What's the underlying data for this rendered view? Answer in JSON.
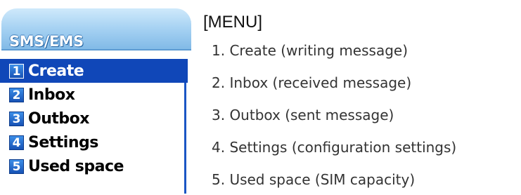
{
  "screen": {
    "title": "SMS/EMS",
    "items": [
      {
        "num": "1",
        "label": "Create"
      },
      {
        "num": "2",
        "label": "Inbox"
      },
      {
        "num": "3",
        "label": "Outbox"
      },
      {
        "num": "4",
        "label": "Settings"
      },
      {
        "num": "5",
        "label": "Used space"
      }
    ],
    "selected_index": 0
  },
  "legend": {
    "title": "[MENU]",
    "lines": [
      "1. Create (writing message)",
      "2. Inbox (received message)",
      "3. Outbox (sent message)",
      "4. Settings (configuration settings)",
      "5. Used space (SIM capacity)"
    ]
  },
  "colors": {
    "selection": "#1047b8",
    "title_bar": "#7fb8e6",
    "number_badge": "#1752b5"
  }
}
